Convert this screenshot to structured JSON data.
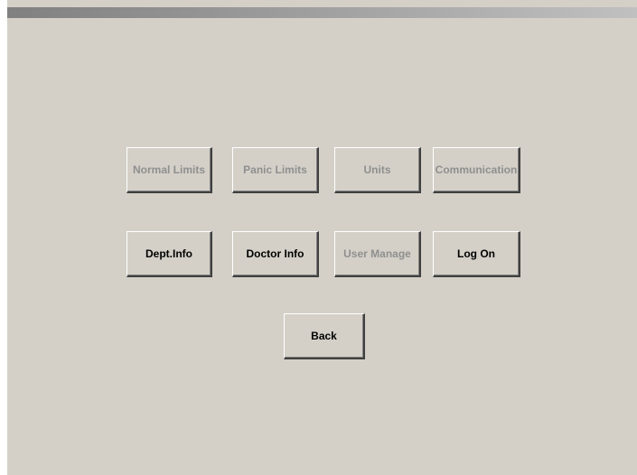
{
  "menu": {
    "row1": [
      {
        "label": "Normal Limits",
        "enabled": false
      },
      {
        "label": "Panic Limits",
        "enabled": false
      },
      {
        "label": "Units",
        "enabled": false
      },
      {
        "label": "Communication",
        "enabled": false
      }
    ],
    "row2": [
      {
        "label": "Dept.Info",
        "enabled": true
      },
      {
        "label": "Doctor Info",
        "enabled": true
      },
      {
        "label": "User Manage",
        "enabled": false
      },
      {
        "label": "Log On",
        "enabled": true
      }
    ],
    "back_label": "Back"
  },
  "colors": {
    "background": "#d4d0c8",
    "disabled_text": "#8f8f8f",
    "enabled_text": "#000000"
  }
}
